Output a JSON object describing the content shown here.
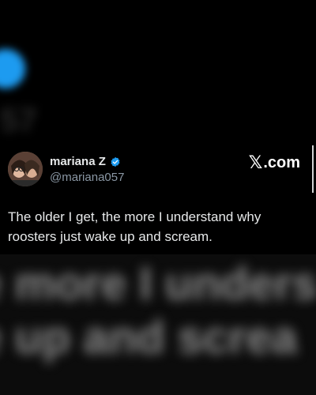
{
  "user": {
    "name": "mariana Z",
    "handle": "@mariana057"
  },
  "brand": {
    "x_glyph": "𝕏",
    "suffix": ".com"
  },
  "tweet": {
    "text": "The older I get, the more I understand why roosters just wake up and scream."
  },
  "background": {
    "blur_top": "57",
    "blur_line_1": "e more I unders",
    "blur_line_2": "e up and screa"
  },
  "colors": {
    "verified": "#1d9bf0",
    "text_primary": "#e7e9ea",
    "text_secondary": "#8b98a5",
    "background": "#000000"
  },
  "icons": {
    "verified": "verified-badge-icon"
  }
}
